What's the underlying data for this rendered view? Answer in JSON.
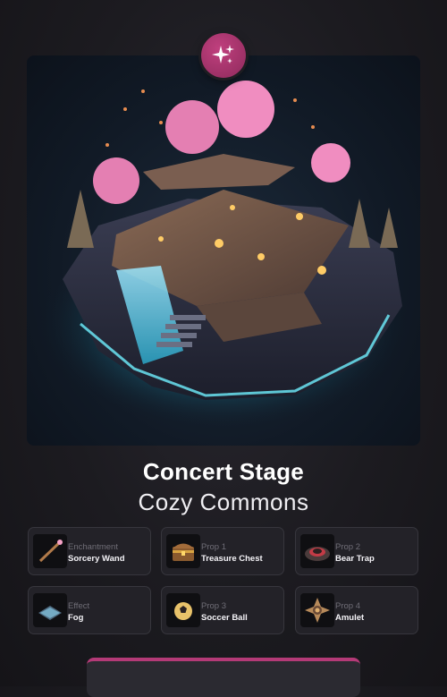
{
  "title": "Concert Stage",
  "subtitle": "Cozy Commons",
  "accent_color": "#b43a77",
  "badge_icon": "sparkles-icon",
  "items": [
    {
      "category": "Enchantment",
      "name": "Sorcery Wand",
      "icon": "wand-icon"
    },
    {
      "category": "Prop 1",
      "name": "Treasure Chest",
      "icon": "treasure-chest-icon"
    },
    {
      "category": "Prop 2",
      "name": "Bear Trap",
      "icon": "bear-trap-icon"
    },
    {
      "category": "Effect",
      "name": "Fog",
      "icon": "fog-icon"
    },
    {
      "category": "Prop 3",
      "name": "Soccer Ball",
      "icon": "soccer-ball-icon"
    },
    {
      "category": "Prop 4",
      "name": "Amulet",
      "icon": "amulet-icon"
    }
  ]
}
